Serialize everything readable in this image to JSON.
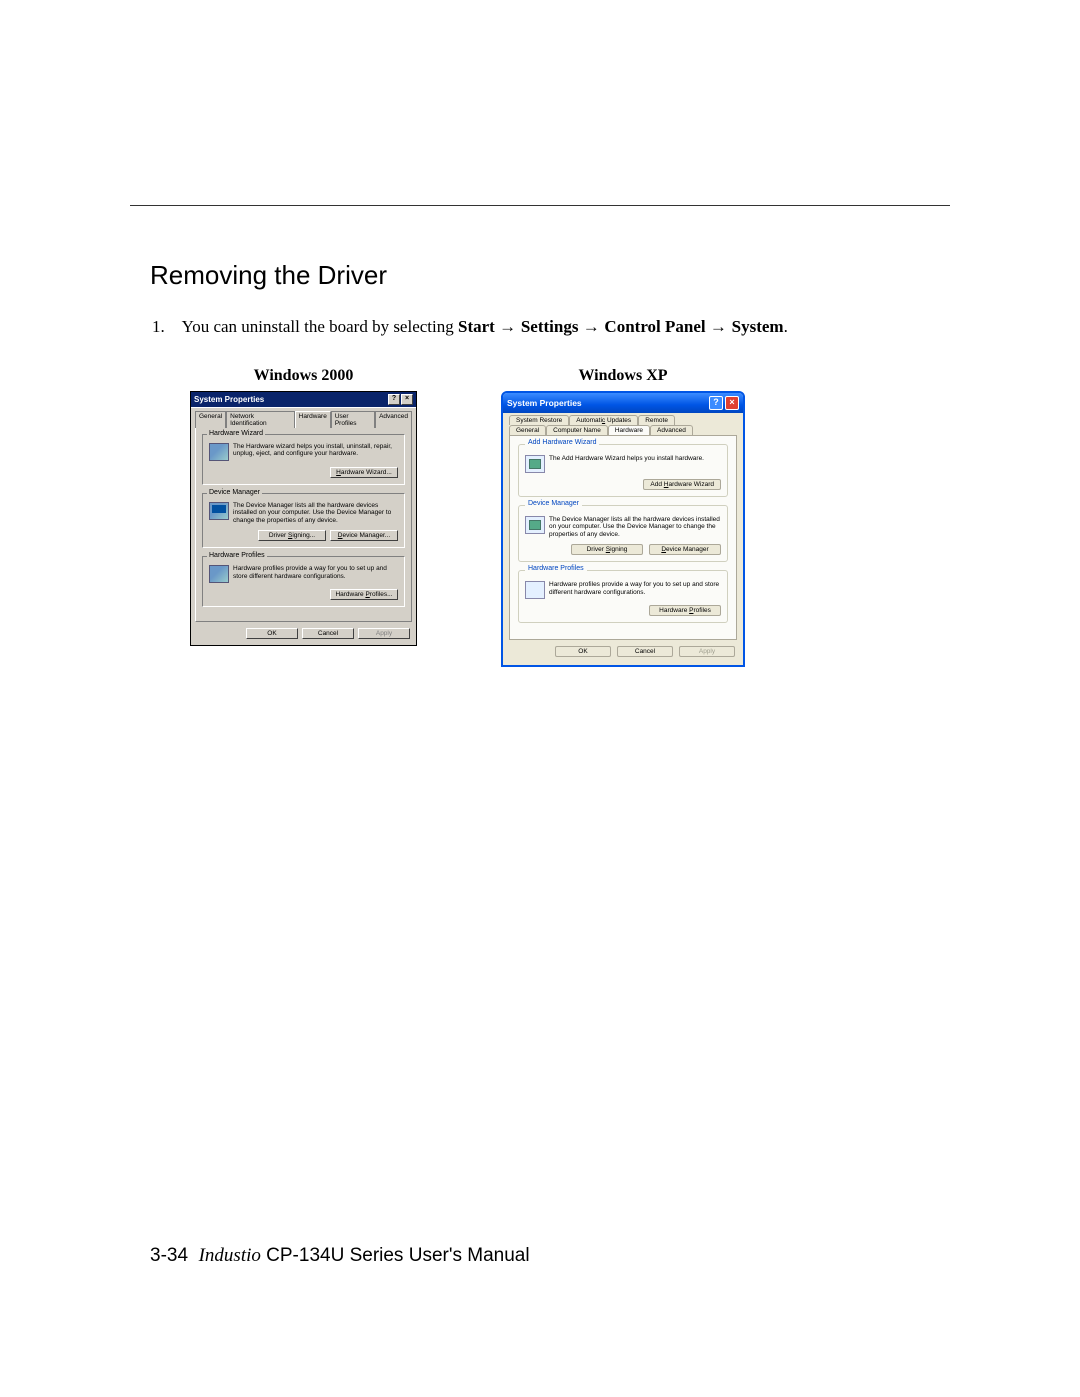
{
  "heading": "Removing the Driver",
  "step": {
    "num": "1.",
    "prefix": "You can uninstall the board by selecting ",
    "path": [
      "Start",
      "Settings",
      "Control Panel",
      "System"
    ],
    "suffix": "."
  },
  "captions": {
    "w2k": "Windows 2000",
    "wxp": "Windows XP"
  },
  "w2k": {
    "title": "System Properties",
    "tabs": [
      "General",
      "Network Identification",
      "Hardware",
      "User Profiles",
      "Advanced"
    ],
    "active_tab": "Hardware",
    "groups": {
      "hw_wizard": {
        "legend": "Hardware Wizard",
        "text": "The Hardware wizard helps you install, uninstall, repair, unplug, eject, and configure your hardware.",
        "button": "Hardware Wizard..."
      },
      "dev_mgr": {
        "legend": "Device Manager",
        "text": "The Device Manager lists all the hardware devices installed on your computer. Use the Device Manager to change the properties of any device.",
        "buttons": [
          "Driver Signing...",
          "Device Manager..."
        ]
      },
      "hw_profiles": {
        "legend": "Hardware Profiles",
        "text": "Hardware profiles provide a way for you to set up and store different hardware configurations.",
        "button": "Hardware Profiles..."
      }
    },
    "bottom": {
      "ok": "OK",
      "cancel": "Cancel",
      "apply": "Apply"
    }
  },
  "wxp": {
    "title": "System Properties",
    "tabs_row1": [
      "System Restore",
      "Automatic Updates",
      "Remote"
    ],
    "tabs_row2": [
      "General",
      "Computer Name",
      "Hardware",
      "Advanced"
    ],
    "active_tab": "Hardware",
    "groups": {
      "add_hw": {
        "legend": "Add Hardware Wizard",
        "text": "The Add Hardware Wizard helps you install hardware.",
        "button": "Add Hardware Wizard"
      },
      "dev_mgr": {
        "legend": "Device Manager",
        "text": "The Device Manager lists all the hardware devices installed on your computer. Use the Device Manager to change the properties of any device.",
        "buttons": [
          "Driver Signing",
          "Device Manager"
        ]
      },
      "hw_profiles": {
        "legend": "Hardware Profiles",
        "text": "Hardware profiles provide a way for you to set up and store different hardware configurations.",
        "button": "Hardware Profiles"
      }
    },
    "bottom": {
      "ok": "OK",
      "cancel": "Cancel",
      "apply": "Apply"
    }
  },
  "footer": {
    "page": "3-34",
    "brand": "Industio",
    "series": "CP-134U Series",
    "tail": "User's Manual"
  },
  "glyphs": {
    "help": "?",
    "close": "×"
  }
}
